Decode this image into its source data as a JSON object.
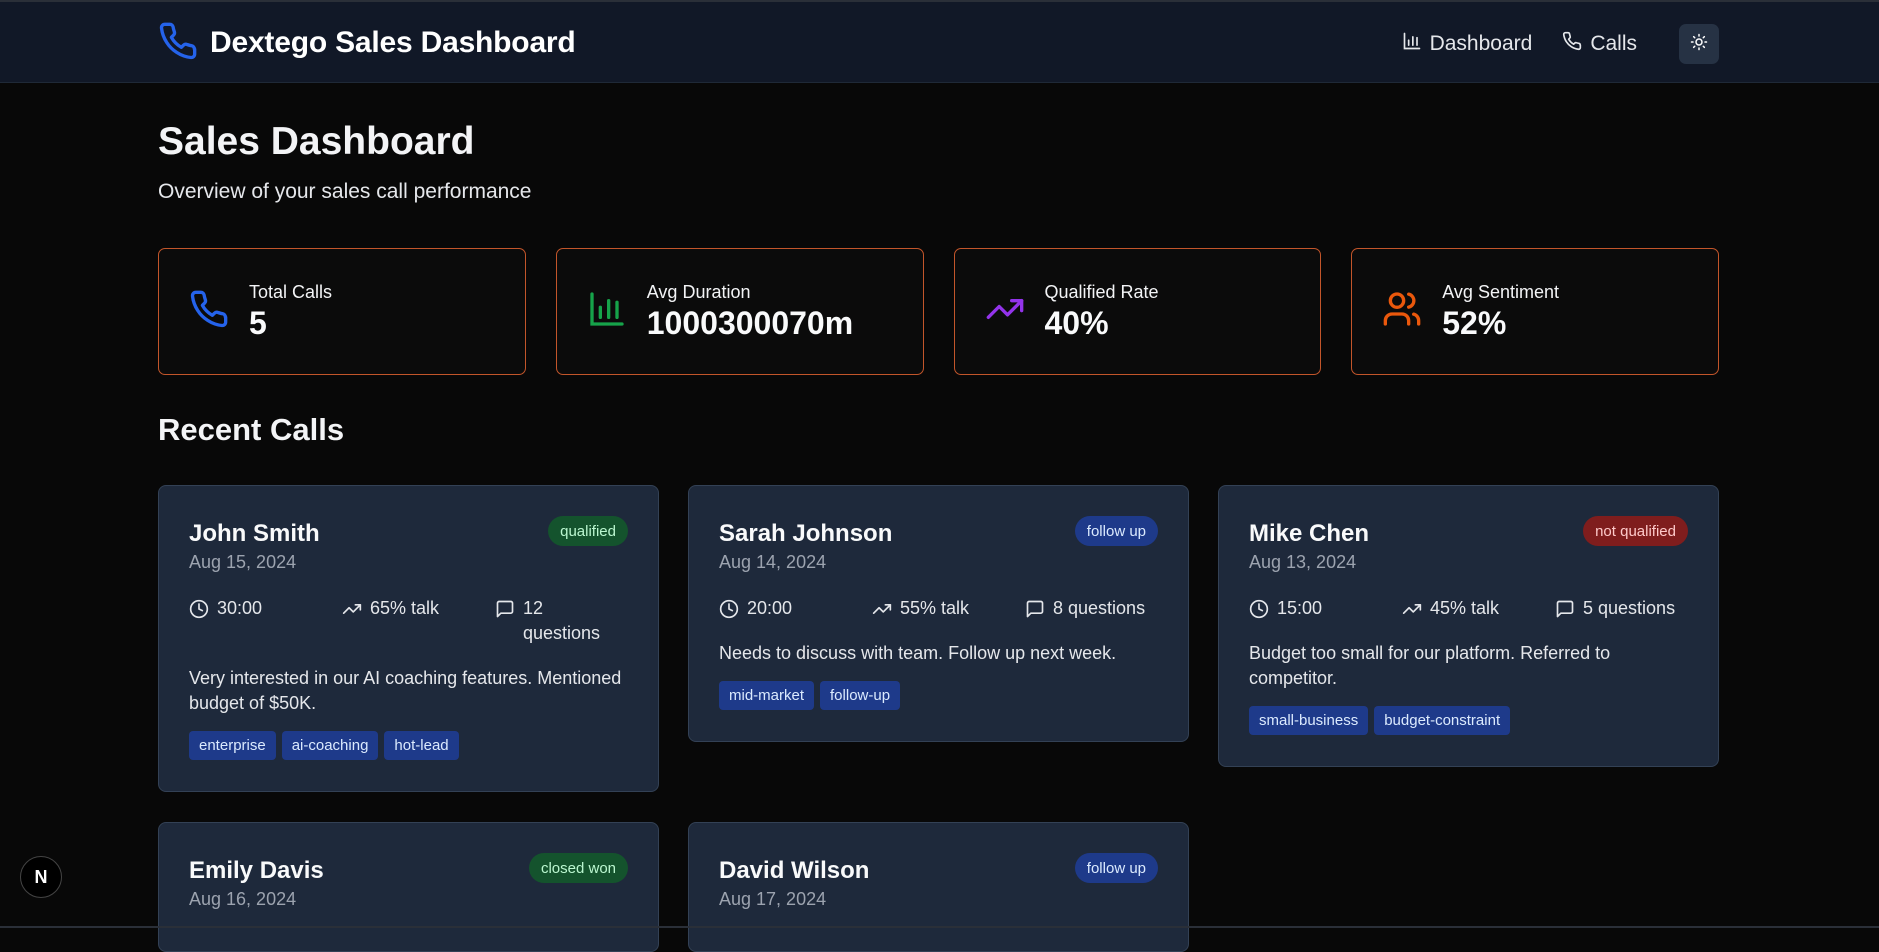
{
  "app": {
    "title": "Dextego Sales Dashboard"
  },
  "nav": {
    "dashboard_label": "Dashboard",
    "calls_label": "Calls"
  },
  "page": {
    "title": "Sales Dashboard",
    "subtitle": "Overview of your sales call performance"
  },
  "stats": [
    {
      "label": "Total Calls",
      "value": "5",
      "icon": "phone-icon",
      "color": "#2563eb"
    },
    {
      "label": "Avg Duration",
      "value": "1000300070m",
      "icon": "bar-chart-icon",
      "color": "#16a34a"
    },
    {
      "label": "Qualified Rate",
      "value": "40%",
      "icon": "trending-up-icon",
      "color": "#9333ea"
    },
    {
      "label": "Avg Sentiment",
      "value": "52%",
      "icon": "users-icon",
      "color": "#ea580c"
    }
  ],
  "recent": {
    "title": "Recent Calls",
    "calls": [
      {
        "name": "John Smith",
        "date": "Aug 15, 2024",
        "status": "qualified",
        "duration": "30:00",
        "talk": "65% talk",
        "questions": "12 questions",
        "note": "Very interested in our AI coaching features. Mentioned budget of $50K.",
        "tags": [
          "enterprise",
          "ai-coaching",
          "hot-lead"
        ]
      },
      {
        "name": "Sarah Johnson",
        "date": "Aug 14, 2024",
        "status": "follow up",
        "duration": "20:00",
        "talk": "55% talk",
        "questions": "8 questions",
        "note": "Needs to discuss with team. Follow up next week.",
        "tags": [
          "mid-market",
          "follow-up"
        ]
      },
      {
        "name": "Mike Chen",
        "date": "Aug 13, 2024",
        "status": "not qualified",
        "duration": "15:00",
        "talk": "45% talk",
        "questions": "5 questions",
        "note": "Budget too small for our platform. Referred to competitor.",
        "tags": [
          "small-business",
          "budget-constraint"
        ]
      },
      {
        "name": "Emily Davis",
        "date": "Aug 16, 2024",
        "status": "closed won"
      },
      {
        "name": "David Wilson",
        "date": "Aug 17, 2024",
        "status": "follow up"
      }
    ]
  },
  "framework_badge": {
    "letter": "N"
  }
}
